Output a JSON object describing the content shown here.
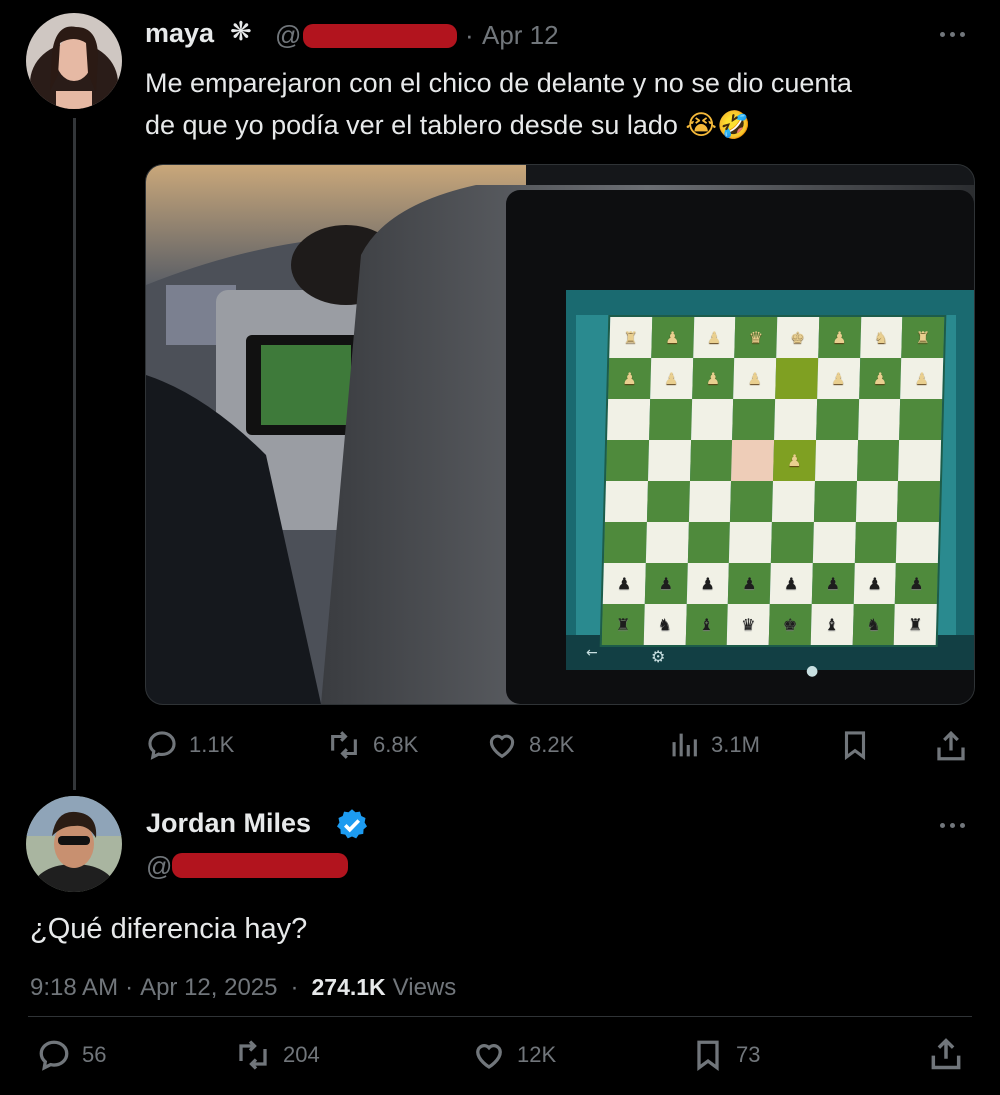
{
  "original_tweet": {
    "author_name": "maya",
    "author_flair": "❋",
    "handle_prefix": "@",
    "date_sep": "·",
    "date": "Apr 12",
    "text_line1": "Me emparejaron con el chico de delante y no se dio cuenta",
    "text_line2": "de que yo podía ver el tablero desde su lado",
    "emojis": "😭🤣",
    "actions": {
      "replies": "1.1K",
      "reposts": "6.8K",
      "likes": "8.2K",
      "views": "3.1M"
    }
  },
  "reply_tweet": {
    "author_name": "Jordan Miles",
    "verified": true,
    "handle_prefix": "@",
    "text": "¿Qué diferencia hay?",
    "time": "9:18 AM",
    "sep1": "·",
    "date": "Apr 12, 2025",
    "sep2": "·",
    "views_count": "274.1K",
    "views_label": "Views",
    "actions": {
      "replies": "56",
      "reposts": "204",
      "likes": "12K",
      "bookmarks": "73"
    }
  },
  "icons": {
    "more": "more-icon",
    "reply": "reply-icon",
    "repost": "repost-icon",
    "like": "like-icon",
    "views": "views-icon",
    "bookmark": "bookmark-icon",
    "share": "share-icon",
    "verified": "verified-badge-icon"
  },
  "colors": {
    "background": "#000000",
    "text": "#e7e9ea",
    "muted": "#71767b",
    "verified": "#1d9bf0",
    "redaction": "#b2141e"
  }
}
